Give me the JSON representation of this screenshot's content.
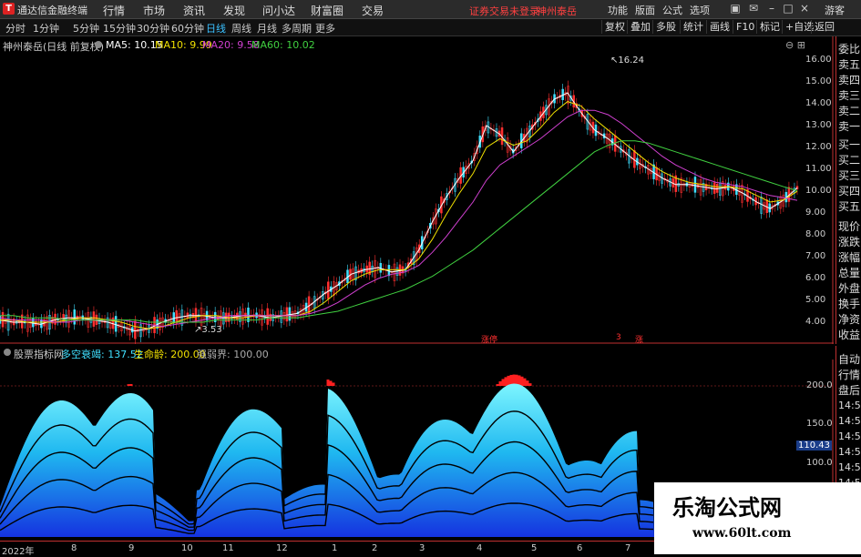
{
  "app": {
    "title": "通达信金融终端",
    "logo_char": "T"
  },
  "menu": [
    "行情",
    "市场",
    "资讯",
    "发现",
    "问小达",
    "财富圈",
    "交易"
  ],
  "status": {
    "login": "证券交易未登录",
    "stock_name": "神州泰岳"
  },
  "menu_right": [
    "功能",
    "版面",
    "公式",
    "选项"
  ],
  "user": "游客",
  "periods": [
    "分时",
    "1分钟",
    "5分钟",
    "15分钟",
    "30分钟",
    "60分钟",
    "日线",
    "周线",
    "月线",
    "多周期",
    "更多"
  ],
  "active_period": "日线",
  "toolbar_right": [
    "复权",
    "叠加",
    "多股",
    "统计",
    "画线",
    "F10",
    "标记",
    "+自选",
    "返回"
  ],
  "chart_header": {
    "title": "神州泰岳(日线 前复权)",
    "ma": [
      {
        "label": "MA5: 10.15",
        "color": "#ffffff"
      },
      {
        "label": "MA10: 9.99",
        "color": "#f0e000"
      },
      {
        "label": "MA20: 9.58",
        "color": "#d040d0"
      },
      {
        "label": "MA60: 10.02",
        "color": "#40d040"
      }
    ]
  },
  "price_axis": [
    "16.00",
    "15.00",
    "14.00",
    "13.00",
    "12.00",
    "11.00",
    "10.00",
    "9.00",
    "8.00",
    "7.00",
    "6.00",
    "5.00",
    "4.00"
  ],
  "annotations": {
    "high": "16.24",
    "low": "3.53"
  },
  "signals": [
    "涨停",
    "3",
    "涨"
  ],
  "side_panel": [
    "委比",
    "卖五",
    "卖四",
    "卖三",
    "卖二",
    "卖一",
    "买一",
    "买二",
    "买三",
    "买四",
    "买五",
    "现价",
    "涨跌",
    "涨幅",
    "总量",
    "外盘",
    "换手",
    "净资",
    "收益"
  ],
  "side_panel_lower": [
    "自动",
    "行情",
    "盘后",
    "14:50",
    "14:50",
    "14:50",
    "14:50",
    "14:50",
    "14:50"
  ],
  "indicator": {
    "name": "股票指标网",
    "items": [
      {
        "label": "多空衰竭: 137.52",
        "color": "#40e0ff"
      },
      {
        "label": "生命龄: 200.00",
        "color": "#f0e000"
      },
      {
        "label": "强弱界: 100.00",
        "color": "#aaaaaa"
      }
    ],
    "axis": [
      "200.0",
      "150.0",
      "100.0"
    ],
    "value_tag": "110.43"
  },
  "x_labels": [
    "2022年",
    "8",
    "9",
    "10",
    "11",
    "12",
    "1",
    "2",
    "3",
    "4",
    "5",
    "6",
    "7"
  ],
  "watermark": {
    "text": "乐淘公式网",
    "url": "www.60lt.com"
  },
  "colors": {
    "up": "#ff3030",
    "down": "#40e0ff",
    "accent": "#3ac0ff"
  },
  "chart_data": {
    "type": "line",
    "title": "神州泰岳(日线 前复权)",
    "ylim": [
      3.5,
      16.5
    ],
    "x": [
      0,
      1,
      2,
      3,
      4,
      5,
      6,
      7,
      8,
      9,
      10,
      11,
      12,
      13,
      14,
      15,
      16,
      17,
      18,
      19,
      20,
      21,
      22,
      23,
      24,
      25,
      26,
      27,
      28,
      29,
      30,
      31,
      32,
      33,
      34,
      35,
      36,
      37,
      38,
      39,
      40,
      41,
      42,
      43,
      44,
      45,
      46,
      47,
      48,
      49,
      50,
      51,
      52,
      53,
      54,
      55,
      56,
      57,
      58,
      59
    ],
    "series": [
      {
        "name": "MA5",
        "values": [
          4.1,
          4.0,
          4.0,
          3.9,
          4.1,
          4.2,
          4.2,
          4.1,
          4.0,
          3.8,
          3.6,
          3.7,
          4.0,
          4.2,
          4.3,
          4.3,
          4.2,
          4.2,
          4.3,
          4.3,
          4.2,
          4.3,
          4.4,
          4.8,
          5.3,
          5.7,
          6.2,
          6.4,
          6.5,
          6.3,
          6.4,
          7.3,
          8.6,
          9.7,
          10.6,
          11.4,
          13.0,
          12.6,
          11.8,
          12.6,
          13.4,
          14.2,
          14.5,
          13.6,
          12.8,
          12.4,
          11.9,
          11.4,
          11.0,
          10.6,
          10.3,
          10.3,
          10.2,
          10.1,
          10.2,
          9.9,
          9.5,
          9.2,
          9.6,
          10.15
        ]
      },
      {
        "name": "MA10",
        "values": [
          4.1,
          4.1,
          4.0,
          4.0,
          4.0,
          4.1,
          4.2,
          4.2,
          4.1,
          4.0,
          3.8,
          3.7,
          3.8,
          4.0,
          4.2,
          4.3,
          4.3,
          4.2,
          4.2,
          4.3,
          4.3,
          4.3,
          4.3,
          4.5,
          4.9,
          5.4,
          5.9,
          6.2,
          6.4,
          6.4,
          6.4,
          6.9,
          7.8,
          8.9,
          9.9,
          10.8,
          12.0,
          12.4,
          12.1,
          12.3,
          12.9,
          13.6,
          14.1,
          13.9,
          13.3,
          12.8,
          12.3,
          11.8,
          11.3,
          10.9,
          10.6,
          10.4,
          10.3,
          10.2,
          10.2,
          10.1,
          9.8,
          9.5,
          9.6,
          9.99
        ]
      },
      {
        "name": "MA20",
        "values": [
          4.2,
          4.1,
          4.1,
          4.1,
          4.0,
          4.0,
          4.1,
          4.1,
          4.1,
          4.1,
          4.0,
          3.9,
          3.8,
          3.9,
          4.0,
          4.1,
          4.2,
          4.3,
          4.3,
          4.3,
          4.3,
          4.3,
          4.3,
          4.4,
          4.6,
          4.9,
          5.3,
          5.7,
          6.0,
          6.2,
          6.3,
          6.6,
          7.2,
          7.9,
          8.7,
          9.5,
          10.5,
          11.2,
          11.6,
          12.0,
          12.4,
          12.9,
          13.4,
          13.7,
          13.7,
          13.5,
          13.1,
          12.6,
          12.1,
          11.6,
          11.2,
          10.9,
          10.6,
          10.4,
          10.3,
          10.2,
          10.0,
          9.8,
          9.7,
          9.58
        ]
      },
      {
        "name": "MA60",
        "values": [
          4.3,
          4.3,
          4.2,
          4.2,
          4.2,
          4.1,
          4.1,
          4.1,
          4.1,
          4.1,
          4.1,
          4.0,
          4.0,
          4.0,
          4.0,
          4.0,
          4.1,
          4.1,
          4.1,
          4.1,
          4.2,
          4.2,
          4.2,
          4.3,
          4.4,
          4.5,
          4.7,
          4.9,
          5.1,
          5.3,
          5.5,
          5.8,
          6.1,
          6.5,
          6.9,
          7.3,
          7.8,
          8.3,
          8.8,
          9.3,
          9.8,
          10.3,
          10.8,
          11.3,
          11.8,
          12.1,
          12.3,
          12.3,
          12.2,
          12.0,
          11.8,
          11.6,
          11.4,
          11.2,
          11.0,
          10.8,
          10.6,
          10.4,
          10.2,
          10.02
        ]
      }
    ]
  }
}
